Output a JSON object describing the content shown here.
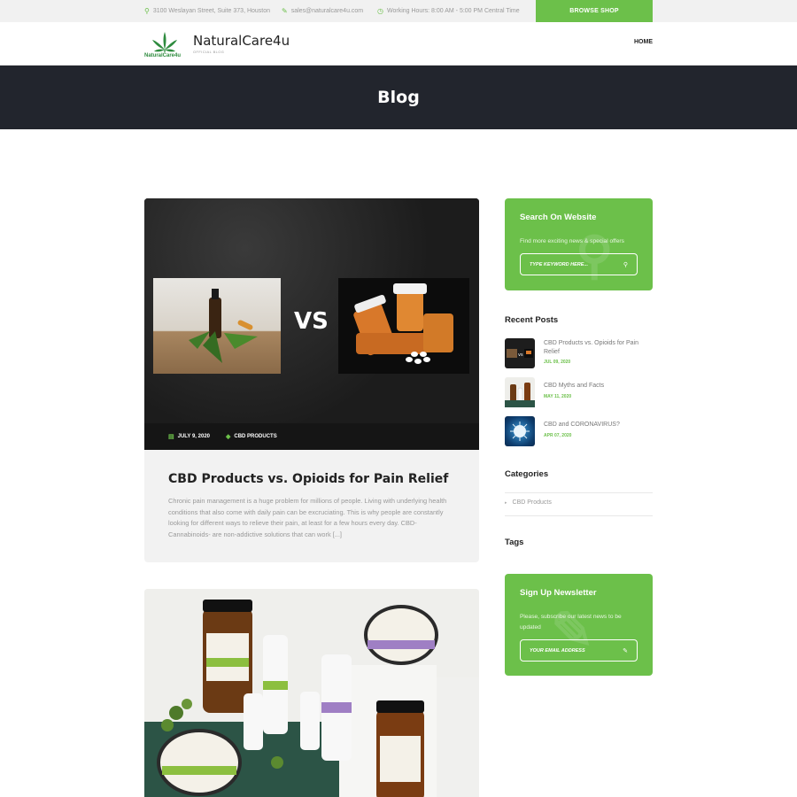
{
  "topbar": {
    "address": "3100 Weslayan Street, Suite 373, Houston",
    "email": "sales@naturalcare4u.com",
    "hours": "Working Hours: 8:00 AM - 5:00 PM Central Time",
    "shop_button": "BROWSE SHOP",
    "icons": {
      "address": "map-pin-icon",
      "email": "pencil-icon",
      "hours": "clock-icon"
    }
  },
  "header": {
    "logo_text": "NaturalCare4u",
    "brand": "NaturalCare4u",
    "brand_sub": "OFFICIAL BLOG",
    "nav": [
      "HOME"
    ]
  },
  "hero": {
    "title": "Blog"
  },
  "posts": [
    {
      "image_label": "VS",
      "date": "JULY 9, 2020",
      "category": "CBD PRODUCTS",
      "title": "CBD Products vs. Opioids for Pain Relief",
      "excerpt": "Chronic pain management is a huge problem for millions of people. Living with underlying health conditions that also come with daily pain can be excruciating. This is why people are constantly looking for different ways to relieve their pain, at least for a few hours every day. CBD- Cannabinoids- are non-addictive solutions that can work [...]"
    }
  ],
  "sidebar": {
    "search": {
      "title": "Search On Website",
      "text": "Find more exciting news & special offers",
      "placeholder": "TYPE KEYWORD HERE..."
    },
    "recent_heading": "Recent Posts",
    "recent_posts": [
      {
        "title": "CBD Products vs. Opioids for Pain Relief",
        "date": "JUL 09, 2020"
      },
      {
        "title": "CBD Myths and Facts",
        "date": "MAY 11, 2020"
      },
      {
        "title": "CBD and CORONAVIRUS?",
        "date": "APR 07, 2020"
      }
    ],
    "categories_heading": "Categories",
    "categories": [
      "CBD Products"
    ],
    "tags_heading": "Tags",
    "newsletter": {
      "title": "Sign Up Newsletter",
      "text": "Please, subscribe our latest news to be updated",
      "placeholder": "YOUR EMAIL ADDRESS"
    }
  },
  "colors": {
    "accent": "#6cc04a",
    "hero_bg": "#22252d"
  }
}
